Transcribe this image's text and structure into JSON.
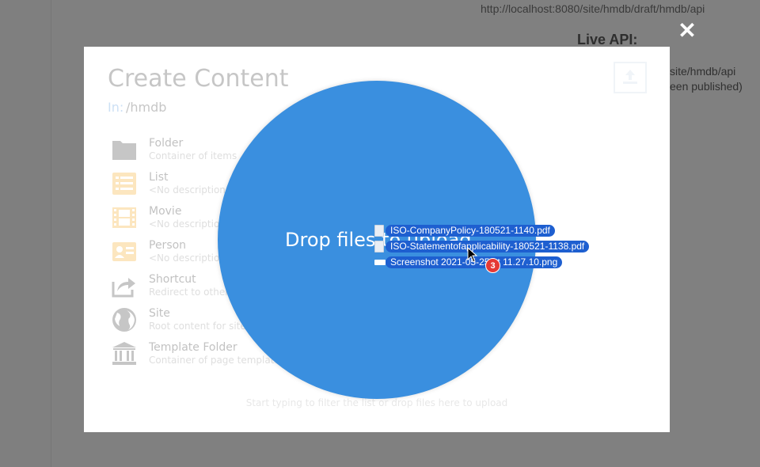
{
  "background": {
    "url_text": "http://localhost:8080/site/hmdb/draft/hmdb/api",
    "live_api_label": "Live API:",
    "api_fragment": "site/hmdb/api",
    "published_fragment": "een published)"
  },
  "modal": {
    "close_label": "✕",
    "title": "Create Content",
    "path_prefix": "In:",
    "path_value": "/hmdb",
    "content_types": [
      {
        "name": "Folder",
        "description": "Container of items",
        "icon": "folder-icon"
      },
      {
        "name": "List",
        "description": "<No description>",
        "icon": "list-icon"
      },
      {
        "name": "Movie",
        "description": "<No description>",
        "icon": "film-icon"
      },
      {
        "name": "Person",
        "description": "<No description>",
        "icon": "person-card-icon"
      },
      {
        "name": "Shortcut",
        "description": "Redirect to other",
        "icon": "share-arrow-icon"
      },
      {
        "name": "Site",
        "description": "Root content for sites",
        "icon": "globe-icon"
      },
      {
        "name": "Template Folder",
        "description": "Container of page templates",
        "icon": "bank-icon"
      }
    ],
    "hint": "Start typing to filter the list or drop files here to upload"
  },
  "dropzone": {
    "label": "Drop files to upload",
    "color": "#3a8fdf"
  },
  "dragged_files": [
    {
      "name": "ISO-CompanyPolicy-180521-1140.pdf",
      "kind": "pdf"
    },
    {
      "name": "ISO-Statementofapplicability-180521-1138.pdf",
      "kind": "pdf"
    },
    {
      "name": "Screenshot 2021-05-25 at 11.27.10.png",
      "kind": "image"
    }
  ],
  "drag_count": "3"
}
